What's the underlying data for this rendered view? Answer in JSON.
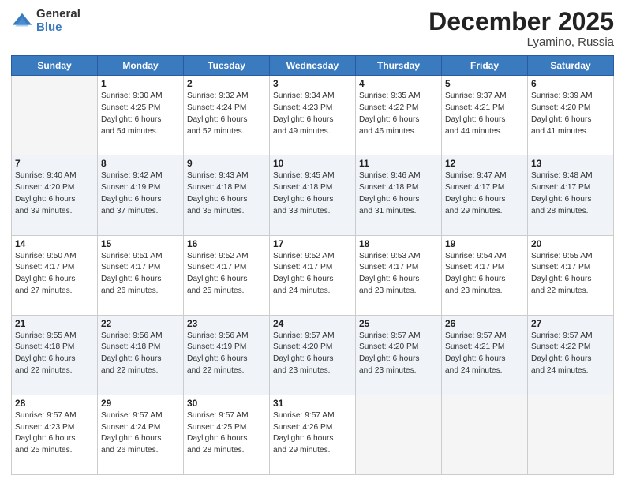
{
  "logo": {
    "general": "General",
    "blue": "Blue"
  },
  "title": {
    "month": "December 2025",
    "location": "Lyamino, Russia"
  },
  "days_of_week": [
    "Sunday",
    "Monday",
    "Tuesday",
    "Wednesday",
    "Thursday",
    "Friday",
    "Saturday"
  ],
  "weeks": [
    [
      {
        "day": "",
        "info": ""
      },
      {
        "day": "1",
        "info": "Sunrise: 9:30 AM\nSunset: 4:25 PM\nDaylight: 6 hours\nand 54 minutes."
      },
      {
        "day": "2",
        "info": "Sunrise: 9:32 AM\nSunset: 4:24 PM\nDaylight: 6 hours\nand 52 minutes."
      },
      {
        "day": "3",
        "info": "Sunrise: 9:34 AM\nSunset: 4:23 PM\nDaylight: 6 hours\nand 49 minutes."
      },
      {
        "day": "4",
        "info": "Sunrise: 9:35 AM\nSunset: 4:22 PM\nDaylight: 6 hours\nand 46 minutes."
      },
      {
        "day": "5",
        "info": "Sunrise: 9:37 AM\nSunset: 4:21 PM\nDaylight: 6 hours\nand 44 minutes."
      },
      {
        "day": "6",
        "info": "Sunrise: 9:39 AM\nSunset: 4:20 PM\nDaylight: 6 hours\nand 41 minutes."
      }
    ],
    [
      {
        "day": "7",
        "info": "Sunrise: 9:40 AM\nSunset: 4:20 PM\nDaylight: 6 hours\nand 39 minutes."
      },
      {
        "day": "8",
        "info": "Sunrise: 9:42 AM\nSunset: 4:19 PM\nDaylight: 6 hours\nand 37 minutes."
      },
      {
        "day": "9",
        "info": "Sunrise: 9:43 AM\nSunset: 4:18 PM\nDaylight: 6 hours\nand 35 minutes."
      },
      {
        "day": "10",
        "info": "Sunrise: 9:45 AM\nSunset: 4:18 PM\nDaylight: 6 hours\nand 33 minutes."
      },
      {
        "day": "11",
        "info": "Sunrise: 9:46 AM\nSunset: 4:18 PM\nDaylight: 6 hours\nand 31 minutes."
      },
      {
        "day": "12",
        "info": "Sunrise: 9:47 AM\nSunset: 4:17 PM\nDaylight: 6 hours\nand 29 minutes."
      },
      {
        "day": "13",
        "info": "Sunrise: 9:48 AM\nSunset: 4:17 PM\nDaylight: 6 hours\nand 28 minutes."
      }
    ],
    [
      {
        "day": "14",
        "info": "Sunrise: 9:50 AM\nSunset: 4:17 PM\nDaylight: 6 hours\nand 27 minutes."
      },
      {
        "day": "15",
        "info": "Sunrise: 9:51 AM\nSunset: 4:17 PM\nDaylight: 6 hours\nand 26 minutes."
      },
      {
        "day": "16",
        "info": "Sunrise: 9:52 AM\nSunset: 4:17 PM\nDaylight: 6 hours\nand 25 minutes."
      },
      {
        "day": "17",
        "info": "Sunrise: 9:52 AM\nSunset: 4:17 PM\nDaylight: 6 hours\nand 24 minutes."
      },
      {
        "day": "18",
        "info": "Sunrise: 9:53 AM\nSunset: 4:17 PM\nDaylight: 6 hours\nand 23 minutes."
      },
      {
        "day": "19",
        "info": "Sunrise: 9:54 AM\nSunset: 4:17 PM\nDaylight: 6 hours\nand 23 minutes."
      },
      {
        "day": "20",
        "info": "Sunrise: 9:55 AM\nSunset: 4:17 PM\nDaylight: 6 hours\nand 22 minutes."
      }
    ],
    [
      {
        "day": "21",
        "info": "Sunrise: 9:55 AM\nSunset: 4:18 PM\nDaylight: 6 hours\nand 22 minutes."
      },
      {
        "day": "22",
        "info": "Sunrise: 9:56 AM\nSunset: 4:18 PM\nDaylight: 6 hours\nand 22 minutes."
      },
      {
        "day": "23",
        "info": "Sunrise: 9:56 AM\nSunset: 4:19 PM\nDaylight: 6 hours\nand 22 minutes."
      },
      {
        "day": "24",
        "info": "Sunrise: 9:57 AM\nSunset: 4:20 PM\nDaylight: 6 hours\nand 23 minutes."
      },
      {
        "day": "25",
        "info": "Sunrise: 9:57 AM\nSunset: 4:20 PM\nDaylight: 6 hours\nand 23 minutes."
      },
      {
        "day": "26",
        "info": "Sunrise: 9:57 AM\nSunset: 4:21 PM\nDaylight: 6 hours\nand 24 minutes."
      },
      {
        "day": "27",
        "info": "Sunrise: 9:57 AM\nSunset: 4:22 PM\nDaylight: 6 hours\nand 24 minutes."
      }
    ],
    [
      {
        "day": "28",
        "info": "Sunrise: 9:57 AM\nSunset: 4:23 PM\nDaylight: 6 hours\nand 25 minutes."
      },
      {
        "day": "29",
        "info": "Sunrise: 9:57 AM\nSunset: 4:24 PM\nDaylight: 6 hours\nand 26 minutes."
      },
      {
        "day": "30",
        "info": "Sunrise: 9:57 AM\nSunset: 4:25 PM\nDaylight: 6 hours\nand 28 minutes."
      },
      {
        "day": "31",
        "info": "Sunrise: 9:57 AM\nSunset: 4:26 PM\nDaylight: 6 hours\nand 29 minutes."
      },
      {
        "day": "",
        "info": ""
      },
      {
        "day": "",
        "info": ""
      },
      {
        "day": "",
        "info": ""
      }
    ]
  ]
}
